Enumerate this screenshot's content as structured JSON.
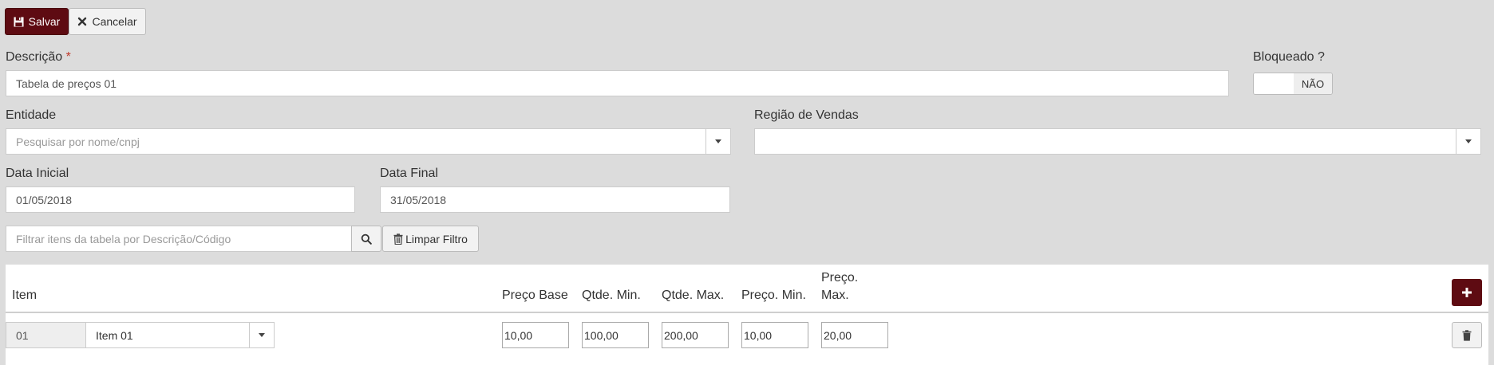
{
  "toolbar": {
    "save_label": "Salvar",
    "cancel_label": "Cancelar"
  },
  "form": {
    "descricao": {
      "label": "Descrição",
      "required_mark": "*",
      "value": "Tabela de preços 01"
    },
    "bloqueado": {
      "label": "Bloqueado ?",
      "toggle_off_label": "NÃO",
      "value": false
    },
    "entidade": {
      "label": "Entidade",
      "placeholder": "Pesquisar por nome/cnpj",
      "value": ""
    },
    "regiao": {
      "label": "Região de Vendas",
      "value": ""
    },
    "data_inicial": {
      "label": "Data Inicial",
      "value": "01/05/2018"
    },
    "data_final": {
      "label": "Data Final",
      "value": "31/05/2018"
    }
  },
  "filter": {
    "placeholder": "Filtrar itens da tabela por Descrição/Código",
    "value": "",
    "clear_label": "Limpar Filtro"
  },
  "table": {
    "headers": {
      "item": "Item",
      "preco_base": "Preço Base",
      "qtde_min": "Qtde. Min.",
      "qtde_max": "Qtde. Max.",
      "preco_min": "Preço. Min.",
      "preco_max_line1": "Preço.",
      "preco_max_line2": "Max."
    },
    "rows": [
      {
        "code": "01",
        "item": "Item 01",
        "preco_base": "10,00",
        "qtde_min": "100,00",
        "qtde_max": "200,00",
        "preco_min": "10,00",
        "preco_max": "20,00"
      }
    ]
  },
  "colors": {
    "accent": "#5e0b12",
    "background": "#dcdcdc"
  },
  "icons": [
    "floppy-disk-icon",
    "close-icon",
    "search-icon",
    "trash-icon",
    "plus-icon",
    "chevron-down-icon"
  ]
}
